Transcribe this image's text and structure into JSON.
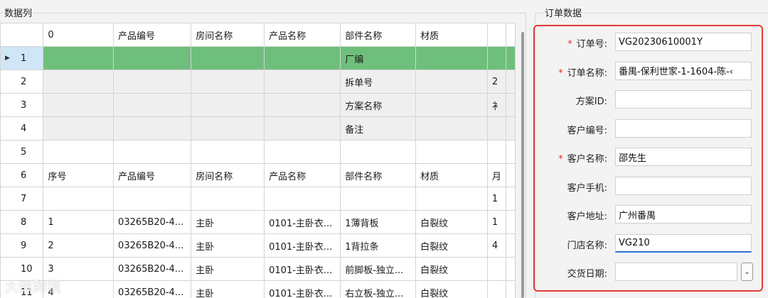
{
  "left_panel": {
    "title": "数据列",
    "rows": [
      {
        "no": "",
        "cells": [
          "0",
          "产品编号",
          "房间名称",
          "产品名称",
          "部件名称",
          "材质",
          ""
        ],
        "style": "header"
      },
      {
        "no": "1",
        "cells": [
          "",
          "",
          "",
          "",
          "厂编",
          "",
          ""
        ],
        "style": "selected"
      },
      {
        "no": "2",
        "cells": [
          "",
          "",
          "",
          "",
          "拆单号",
          "",
          "2"
        ],
        "style": "gray"
      },
      {
        "no": "3",
        "cells": [
          "",
          "",
          "",
          "",
          "方案名称",
          "",
          "衤"
        ],
        "style": "gray"
      },
      {
        "no": "4",
        "cells": [
          "",
          "",
          "",
          "",
          "备注",
          "",
          ""
        ],
        "style": "gray"
      },
      {
        "no": "5",
        "cells": [
          "",
          "",
          "",
          "",
          "",
          "",
          ""
        ],
        "style": "white"
      },
      {
        "no": "6",
        "cells": [
          "序号",
          "产品编号",
          "房间名称",
          "产品名称",
          "部件名称",
          "材质",
          "月"
        ],
        "style": "white"
      },
      {
        "no": "7",
        "cells": [
          "",
          "",
          "",
          "",
          "",
          "",
          "1"
        ],
        "style": "white"
      },
      {
        "no": "8",
        "cells": [
          "1",
          "03265B20-4...",
          "主卧",
          "0101-主卧衣...",
          "1薄背板",
          "白裂纹",
          "1"
        ],
        "style": "white"
      },
      {
        "no": "9",
        "cells": [
          "2",
          "03265B20-4...",
          "主卧",
          "0101-主卧衣...",
          "1背拉条",
          "白裂纹",
          "4"
        ],
        "style": "white"
      },
      {
        "no": "10",
        "cells": [
          "3",
          "03265B20-4...",
          "主卧",
          "0101-主卧衣...",
          "前脚板-独立...",
          "白裂纹",
          ""
        ],
        "style": "white"
      },
      {
        "no": "11",
        "cells": [
          "4",
          "03265B20-4...",
          "主卧",
          "0101-主卧衣...",
          "右立板-独立...",
          "白裂纹",
          ""
        ],
        "style": "white"
      }
    ]
  },
  "right_panel": {
    "title": "订单数据",
    "fields": [
      {
        "label": "订单号:",
        "value": "VG20230610001Y",
        "required": true,
        "focused": false
      },
      {
        "label": "订单名称:",
        "value": "番禺-保利世家-1-1604-陈-‹",
        "required": true,
        "focused": false
      },
      {
        "label": "方案ID:",
        "value": "",
        "required": false,
        "focused": false
      },
      {
        "label": "客户编号:",
        "value": "",
        "required": false,
        "focused": false
      },
      {
        "label": "客户名称:",
        "value": "邵先生",
        "required": true,
        "focused": false
      },
      {
        "label": "客户手机:",
        "value": "",
        "required": false,
        "focused": false
      },
      {
        "label": "客户地址:",
        "value": "广州番禺",
        "required": false,
        "focused": false
      },
      {
        "label": "门店名称:",
        "value": "VG210",
        "required": false,
        "focused": true
      }
    ],
    "date_field": {
      "label": "交货日期:",
      "value": "",
      "button_glyph": "⌄"
    }
  },
  "required_mark": "*",
  "row_arrow": "▶",
  "watermark": "大数跨境",
  "colors": {
    "selected_row": "#6fbf7c",
    "highlight_border": "#e23b35",
    "required": "#e0302a"
  }
}
